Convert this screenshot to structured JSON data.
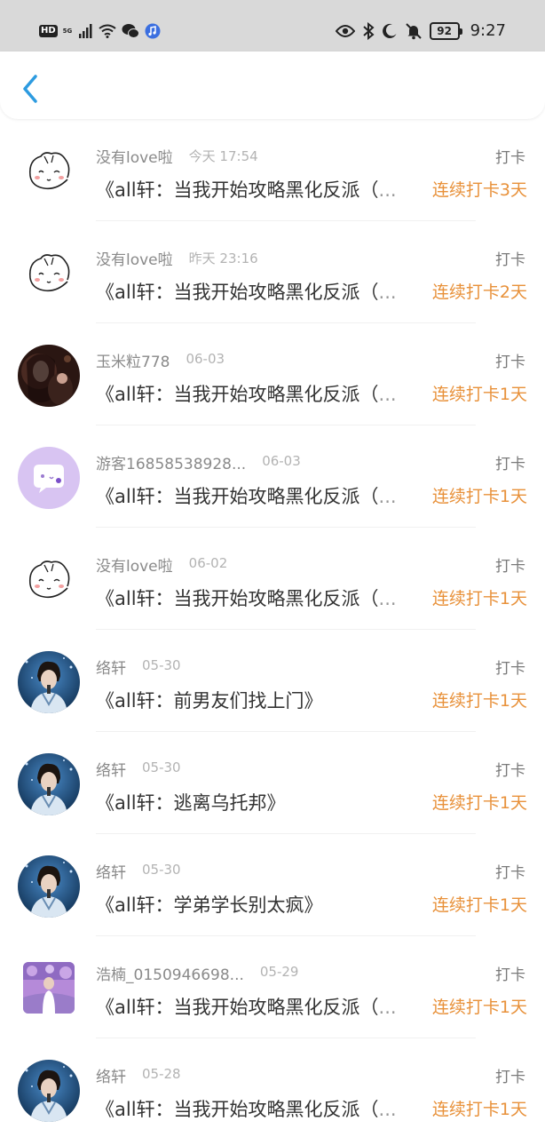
{
  "status_bar": {
    "hd": "HD",
    "net": "5G",
    "battery": "92",
    "time": "9:27",
    "icons_left": [
      "signal-icon",
      "wifi-icon",
      "wechat-icon",
      "music-icon"
    ],
    "icons_right": [
      "eye-icon",
      "bluetooth-icon",
      "moon-icon",
      "mute-icon"
    ]
  },
  "header": {
    "back_icon": "chevron-left-icon",
    "accent": "#2d9be0"
  },
  "colors": {
    "streak": "#e8913a",
    "username": "#8a8a8a",
    "date": "#b3b3b3"
  },
  "rows": [
    {
      "avatar": "doodle",
      "username": "没有love啦",
      "date": "今天 17:54",
      "type": "打卡",
      "title": "《all轩：当我开始攻略黑化反派（",
      "ellipsis": "...",
      "streak": "连续打卡3天"
    },
    {
      "avatar": "doodle",
      "username": "没有love啦",
      "date": "昨天 23:16",
      "type": "打卡",
      "title": "《all轩：当我开始攻略黑化反派（",
      "ellipsis": "...",
      "streak": "连续打卡2天"
    },
    {
      "avatar": "dark-photo",
      "username": "玉米粒778",
      "date": "06-03",
      "type": "打卡",
      "title": "《all轩：当我开始攻略黑化反派（",
      "ellipsis": "...",
      "streak": "连续打卡1天"
    },
    {
      "avatar": "purple-chat",
      "username": "游客16858538928...",
      "date": "06-03",
      "type": "打卡",
      "title": "《all轩：当我开始攻略黑化反派（",
      "ellipsis": "...",
      "streak": "连续打卡1天"
    },
    {
      "avatar": "doodle",
      "username": "没有love啦",
      "date": "06-02",
      "type": "打卡",
      "title": "《all轩：当我开始攻略黑化反派（",
      "ellipsis": "...",
      "streak": "连续打卡1天"
    },
    {
      "avatar": "blue-photo",
      "username": "络轩",
      "date": "05-30",
      "type": "打卡",
      "title": "《all轩：前男友们找上门》",
      "ellipsis": "",
      "streak": "连续打卡1天"
    },
    {
      "avatar": "blue-photo",
      "username": "络轩",
      "date": "05-30",
      "type": "打卡",
      "title": "《all轩：逃离乌托邦》",
      "ellipsis": "",
      "streak": "连续打卡1天"
    },
    {
      "avatar": "blue-photo",
      "username": "络轩",
      "date": "05-30",
      "type": "打卡",
      "title": "《all轩：学弟学长别太疯》",
      "ellipsis": "",
      "streak": "连续打卡1天"
    },
    {
      "avatar": "purple-square",
      "username": "浩楠_0150946698...",
      "date": "05-29",
      "type": "打卡",
      "title": "《all轩：当我开始攻略黑化反派（",
      "ellipsis": "...",
      "streak": "连续打卡1天"
    },
    {
      "avatar": "blue-photo",
      "username": "络轩",
      "date": "05-28",
      "type": "打卡",
      "title": "《all轩：当我开始攻略黑化反派（",
      "ellipsis": "...",
      "streak": "连续打卡1天"
    }
  ]
}
